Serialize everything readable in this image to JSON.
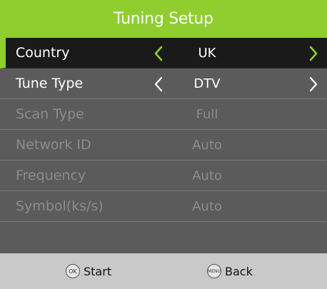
{
  "title": "Tuning Setup",
  "accent_color": "#8fce2e",
  "rows": [
    {
      "label": "Country",
      "value": "UK",
      "selected": true,
      "enabled": true,
      "arrows": true
    },
    {
      "label": "Tune Type",
      "value": "DTV",
      "selected": false,
      "enabled": true,
      "arrows": true
    },
    {
      "label": "Scan Type",
      "value": "Full",
      "selected": false,
      "enabled": false,
      "arrows": false
    },
    {
      "label": "Network ID",
      "value": "Auto",
      "selected": false,
      "enabled": false,
      "arrows": false
    },
    {
      "label": "Frequency",
      "value": "Auto",
      "selected": false,
      "enabled": false,
      "arrows": false
    },
    {
      "label": "Symbol(ks/s)",
      "value": "Auto",
      "selected": false,
      "enabled": false,
      "arrows": false
    }
  ],
  "footer": {
    "start_icon": "OK",
    "start_label": "Start",
    "back_icon": "MENU",
    "back_label": "Back"
  },
  "icons": {
    "left": "chevron-left-icon",
    "right": "chevron-right-icon",
    "ok": "ok-button-icon",
    "menu": "menu-button-icon"
  }
}
